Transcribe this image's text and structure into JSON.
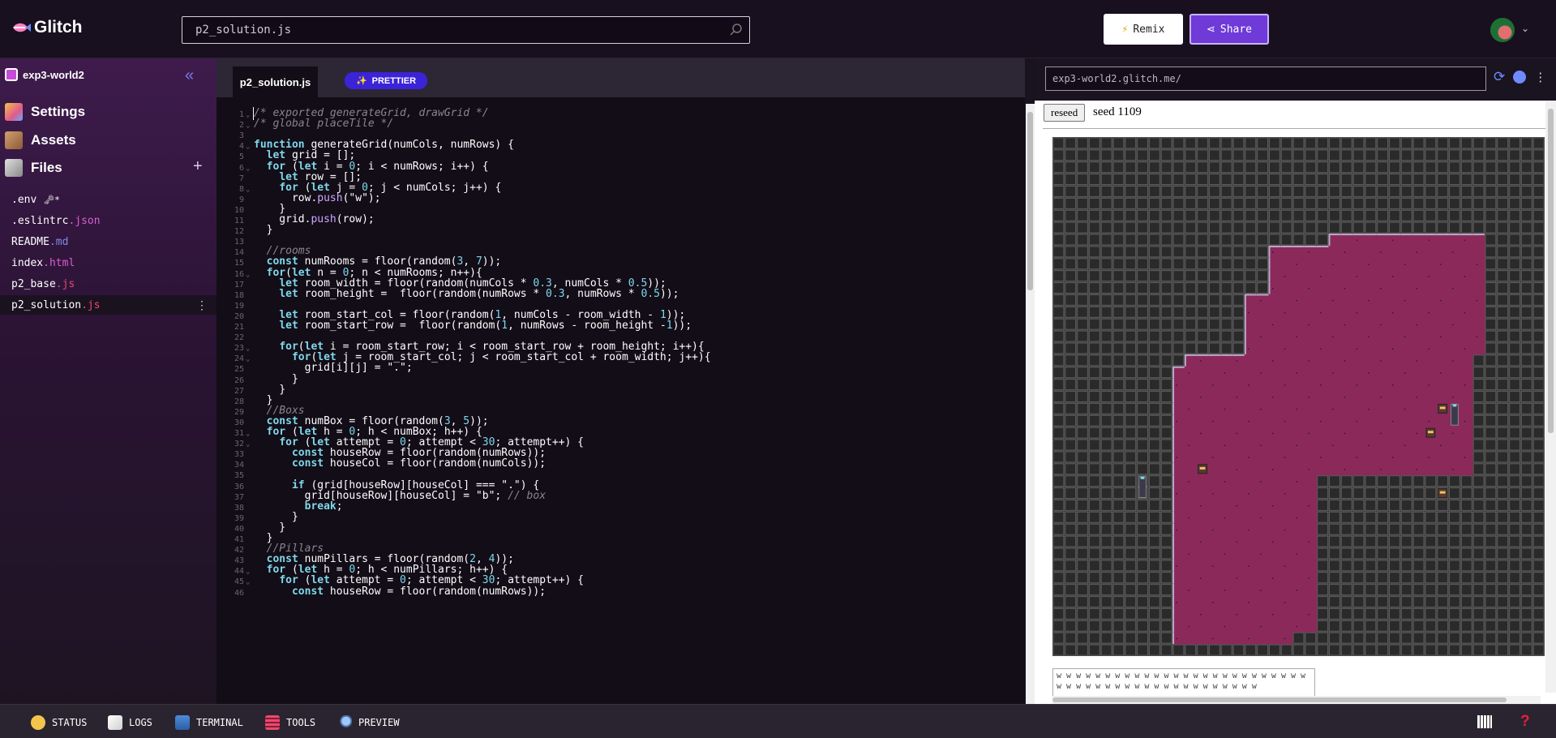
{
  "app": {
    "logo_text": "Glitch",
    "search_value": "p2_solution.js"
  },
  "header": {
    "remix_label": "Remix",
    "share_label": "Share"
  },
  "sidebar": {
    "project_name": "exp3-world2",
    "nav": [
      {
        "label": "Settings"
      },
      {
        "label": "Assets"
      },
      {
        "label": "Files"
      }
    ],
    "files": [
      {
        "base": ".env",
        "ext": "",
        "suffix": "🗝*"
      },
      {
        "base": ".eslintrc",
        "ext": ".json"
      },
      {
        "base": "README",
        "ext": ".md"
      },
      {
        "base": "index",
        "ext": ".html"
      },
      {
        "base": "p2_base",
        "ext": ".js"
      },
      {
        "base": "p2_solution",
        "ext": ".js"
      }
    ],
    "selected_file": "p2_solution.js"
  },
  "editor": {
    "tab_label": "p2_solution.js",
    "prettier_label": "PRETTIER",
    "lines": [
      "/* exported generateGrid, drawGrid */",
      "/* global placeTile */",
      "",
      "function generateGrid(numCols, numRows) {",
      "  let grid = [];",
      "  for (let i = 0; i < numRows; i++) {",
      "    let row = [];",
      "    for (let j = 0; j < numCols; j++) {",
      "      row.push(\"w\");",
      "    }",
      "    grid.push(row);",
      "  }",
      "",
      "  //rooms",
      "  const numRooms = floor(random(3, 7));",
      "  for(let n = 0; n < numRooms; n++){",
      "    let room_width = floor(random(numCols * 0.3, numCols * 0.5));",
      "    let room_height =  floor(random(numRows * 0.3, numRows * 0.5));",
      "",
      "    let room_start_col = floor(random(1, numCols - room_width - 1));",
      "    let room_start_row =  floor(random(1, numRows - room_height -1));",
      "",
      "    for(let i = room_start_row; i < room_start_row + room_height; i++){",
      "      for(let j = room_start_col; j < room_start_col + room_width; j++){",
      "        grid[i][j] = \".\";",
      "      }",
      "    }",
      "  }",
      "  //Boxs",
      "  const numBox = floor(random(3, 5));",
      "  for (let h = 0; h < numBox; h++) {",
      "    for (let attempt = 0; attempt < 30; attempt++) {",
      "      const houseRow = floor(random(numRows));",
      "      const houseCol = floor(random(numCols));",
      "",
      "      if (grid[houseRow][houseCol] === \".\") {",
      "        grid[houseRow][houseCol] = \"b\"; // box",
      "        break;",
      "      }",
      "    }",
      "  }",
      "  //Pillars",
      "  const numPillars = floor(random(2, 4));",
      "  for (let h = 0; h < numPillars; h++) {",
      "    for (let attempt = 0; attempt < 30; attempt++) {",
      "      const houseRow = floor(random(numRows));"
    ]
  },
  "preview": {
    "url": "exp3-world2.glitch.me/",
    "reseed_label": "reseed",
    "seed_text": "seed 1109",
    "ascii_lines": [
      "w w w w w w w w w w w w w w w w w w w w w w w w w w",
      "w w w w w w w w w w w w w w w w w w w w w"
    ]
  },
  "statusbar": {
    "items": [
      "STATUS",
      "LOGS",
      "TERMINAL",
      "TOOLS",
      "PREVIEW"
    ],
    "help_label": "?"
  },
  "colors": {
    "accent": "#6f3ad8",
    "floor": "#8b2a5a",
    "wall": "#424242",
    "keyword": "#7fd8ea",
    "comment": "#8a8490"
  },
  "map": {
    "cols": 41,
    "rows": 43,
    "floor_rects": [
      [
        16,
        34,
        13,
        27
      ],
      [
        11,
        21,
        18,
        40
      ],
      [
        10,
        19,
        19,
        41
      ],
      [
        18,
        34,
        9,
        27
      ],
      [
        23,
        35,
        8,
        17
      ],
      [
        16,
        31,
        15,
        18
      ]
    ],
    "items": [
      {
        "type": "box",
        "col": 12,
        "row": 27
      },
      {
        "type": "pillar",
        "col": 7,
        "row": 29
      },
      {
        "type": "box",
        "col": 31,
        "row": 24
      },
      {
        "type": "box",
        "col": 32,
        "row": 29
      },
      {
        "type": "pillar",
        "col": 33,
        "row": 23
      },
      {
        "type": "box",
        "col": 32,
        "row": 22
      }
    ]
  }
}
